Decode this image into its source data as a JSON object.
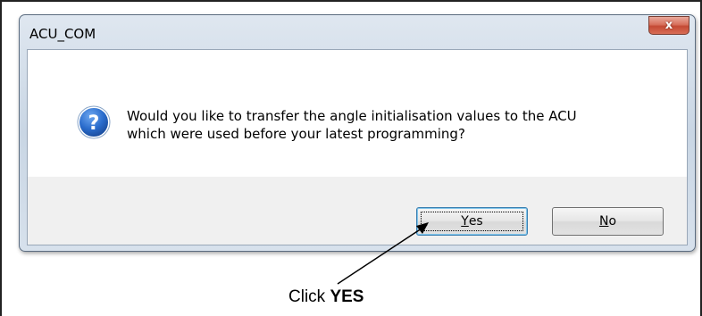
{
  "dialog": {
    "title": "ACU_COM",
    "close_label": "x",
    "message_line1": "Would you like to transfer the angle initialisation values to the ACU",
    "message_line2": "which were used before your latest programming?",
    "icon": "question-icon",
    "buttons": {
      "yes_key": "Y",
      "yes_rest": "es",
      "no_key": "N",
      "no_rest": "o"
    }
  },
  "annotation": {
    "prefix": "Click ",
    "emphasis": "YES"
  },
  "colors": {
    "close_button": "#c44a34",
    "icon_blue": "#1f5fb8",
    "focus_border": "#3c7fb1"
  }
}
